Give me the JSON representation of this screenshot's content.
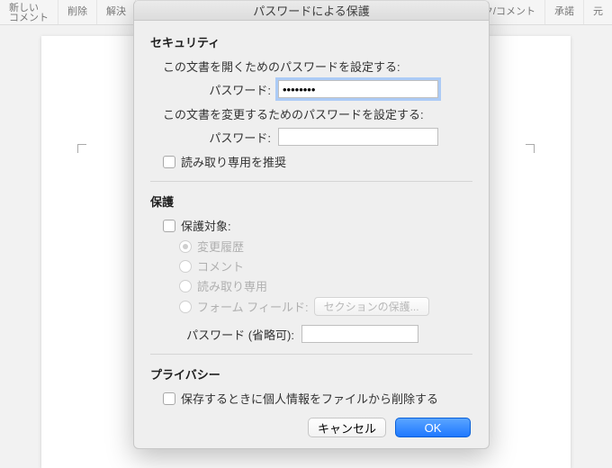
{
  "bgToolbar": {
    "item1": "新しい\nコメント",
    "item2": "削除",
    "item3": "解決",
    "item4": "ック/コメント",
    "item5": "承諾",
    "item6": "元"
  },
  "dialog": {
    "title": "パスワードによる保護",
    "security": {
      "heading": "セキュリティ",
      "openPrompt": "この文書を開くためのパスワードを設定する:",
      "openLabel": "パスワード:",
      "openValue": "●●●●●●●●",
      "modifyPrompt": "この文書を変更するためのパスワードを設定する:",
      "modifyLabel": "パスワード:",
      "modifyValue": "",
      "readonlyRec": "読み取り専用を推奨"
    },
    "protection": {
      "heading": "保護",
      "protectTarget": "保護対象:",
      "radios": {
        "trackChanges": "変更履歴",
        "comments": "コメント",
        "readonly": "読み取り専用",
        "formFields": "フォーム フィールド:"
      },
      "sectionProtectBtn": "セクションの保護...",
      "optionalPwLabel": "パスワード (省略可):",
      "optionalPwValue": ""
    },
    "privacy": {
      "heading": "プライバシー",
      "removePI": "保存するときに個人情報をファイルから削除する"
    },
    "buttons": {
      "cancel": "キャンセル",
      "ok": "OK"
    }
  }
}
